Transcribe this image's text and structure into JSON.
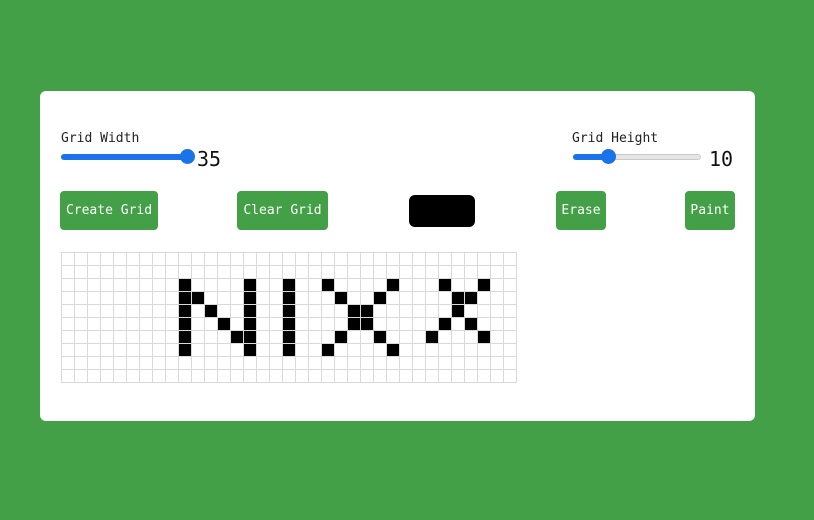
{
  "controls": {
    "width": {
      "label": "Grid Width",
      "value": "35",
      "min": 1,
      "max": 35,
      "level": 1.0
    },
    "height": {
      "label": "Grid Height",
      "value": "10",
      "min": 1,
      "max": 35,
      "level": 0.27
    }
  },
  "buttons": {
    "create": "Create Grid",
    "clear": "Clear Grid",
    "erase": "Erase",
    "paint": "Paint"
  },
  "colors": {
    "background": "#43a047",
    "button": "#43a047",
    "accent": "#1a73e8",
    "paint": "#000000",
    "cell_empty": "#ffffff",
    "cell_border": "#d9d9d9"
  },
  "grid": {
    "cols": 35,
    "rows": 10,
    "filled": [
      [
        2,
        9
      ],
      [
        2,
        14
      ],
      [
        2,
        17
      ],
      [
        2,
        20
      ],
      [
        2,
        25
      ],
      [
        2,
        29
      ],
      [
        2,
        32
      ],
      [
        3,
        9
      ],
      [
        3,
        10
      ],
      [
        3,
        14
      ],
      [
        3,
        17
      ],
      [
        3,
        21
      ],
      [
        3,
        24
      ],
      [
        3,
        30
      ],
      [
        3,
        31
      ],
      [
        4,
        9
      ],
      [
        4,
        11
      ],
      [
        4,
        14
      ],
      [
        4,
        17
      ],
      [
        4,
        22
      ],
      [
        4,
        23
      ],
      [
        4,
        30
      ],
      [
        5,
        9
      ],
      [
        5,
        12
      ],
      [
        5,
        14
      ],
      [
        5,
        17
      ],
      [
        5,
        22
      ],
      [
        5,
        23
      ],
      [
        5,
        29
      ],
      [
        5,
        31
      ],
      [
        6,
        9
      ],
      [
        6,
        13
      ],
      [
        6,
        14
      ],
      [
        6,
        17
      ],
      [
        6,
        21
      ],
      [
        6,
        24
      ],
      [
        6,
        28
      ],
      [
        6,
        32
      ],
      [
        7,
        9
      ],
      [
        7,
        14
      ],
      [
        7,
        17
      ],
      [
        7,
        20
      ],
      [
        7,
        25
      ]
    ]
  }
}
